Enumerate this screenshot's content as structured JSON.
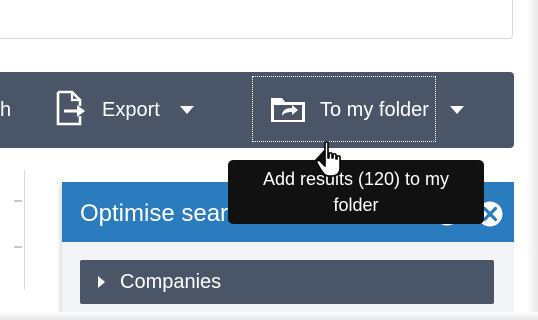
{
  "toolbar": {
    "partial_label": "h",
    "export_label": "Export",
    "folder_label": "To my folder"
  },
  "tooltip": {
    "line1": "Add results (120) to my",
    "line2": "folder"
  },
  "optimise_panel": {
    "title": "Optimise search",
    "rows": [
      {
        "label": "Companies"
      }
    ]
  },
  "colors": {
    "toolbar": "#4a5568",
    "panel_header": "#2b7bbf",
    "tooltip": "#111111"
  },
  "icons": {
    "export": "export-icon",
    "folder": "folder-share-icon",
    "collapse": "double-chevron-icon",
    "close": "close-circle-icon",
    "cursor": "hand-pointer-icon"
  }
}
